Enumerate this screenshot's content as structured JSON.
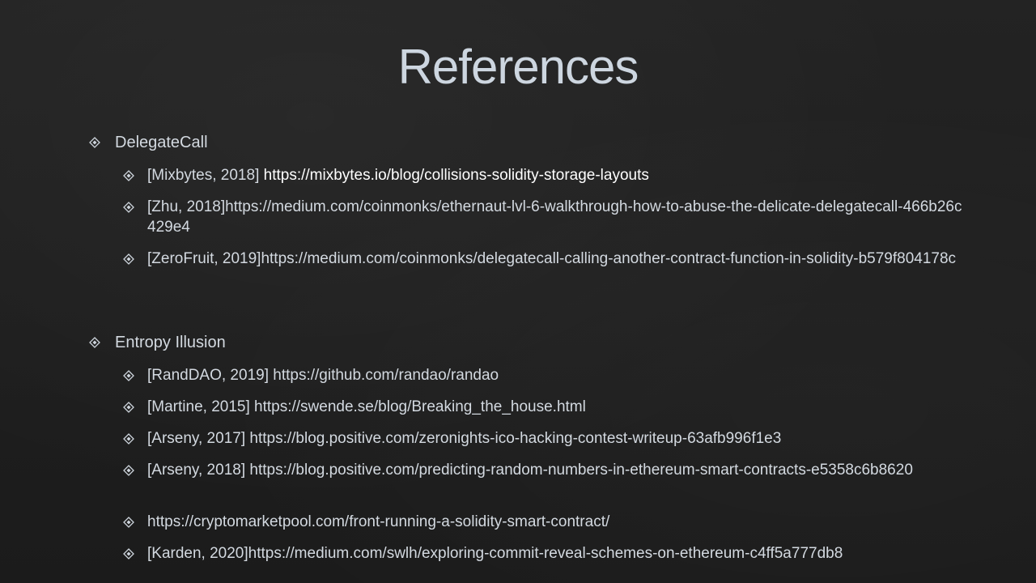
{
  "title": "References",
  "sections": [
    {
      "heading": "DelegateCall",
      "items": [
        {
          "cite": "[Mixbytes, 2018]",
          "url": "https://mixbytes.io/blog/collisions-solidity-storage-layouts"
        },
        {
          "text": "[Zhu, 2018]https://medium.com/coinmonks/ethernaut-lvl-6-walkthrough-how-to-abuse-the-delicate-delegatecall-466b26c429e4"
        },
        {
          "text": "[ZeroFruit, 2019]https://medium.com/coinmonks/delegatecall-calling-another-contract-function-in-solidity-b579f804178c"
        }
      ]
    },
    {
      "heading": "Entropy Illusion",
      "items": [
        {
          "text": "[RandDAO, 2019] https://github.com/randao/randao"
        },
        {
          "text": "[Martine, 2015] https://swende.se/blog/Breaking_the_house.html"
        },
        {
          "text": "[Arseny, 2017] https://blog.positive.com/zeronights-ico-hacking-contest-writeup-63afb996f1e3"
        },
        {
          "text": "[Arseny, 2018] https://blog.positive.com/predicting-random-numbers-in-ethereum-smart-contracts-e5358c6b8620"
        },
        {
          "text": "https://cryptomarketpool.com/front-running-a-solidity-smart-contract/"
        },
        {
          "text": "[Karden, 2020]https://medium.com/swlh/exploring-commit-reveal-schemes-on-ethereum-c4ff5a777db8"
        }
      ]
    }
  ],
  "colors": {
    "background": "#1e1e1e",
    "title": "#cdd6e0",
    "text": "#d3d9e0",
    "highlight_link": "#ffffff"
  },
  "icons": {
    "bullet": "diamond-bullet-icon"
  }
}
